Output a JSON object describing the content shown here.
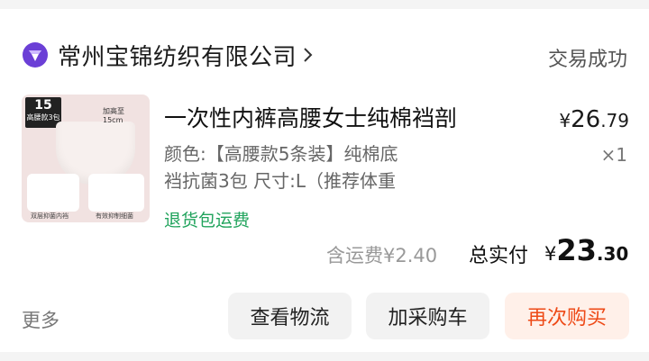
{
  "store": {
    "name": "常州宝锦纺织有限公司",
    "status": "交易成功",
    "icon": "shop-diamond-icon",
    "accent": "#6b3fd6"
  },
  "product": {
    "thumb_badge": "15",
    "thumb_badge_sub": "高腰款3包",
    "thumb_label_1": "加高至",
    "thumb_label_2": "15cm",
    "thumb_caption_1": "双层抑菌内裆",
    "thumb_caption_2": "有效抑制细菌",
    "title": "一次性内裤高腰女士纯棉裆剖",
    "spec_line1": "颜色:【高腰款5条装】纯棉底",
    "spec_line2": "裆抗菌3包 尺寸:L（推荐体重",
    "returns": "退货包运费",
    "price_currency": "¥",
    "price_int": "26",
    "price_dec": ".79",
    "quantity": "×1"
  },
  "summary": {
    "shipping": "含运费¥2.40",
    "total_label": "总实付",
    "total_currency": "¥",
    "total_int": "23",
    "total_dec": ".30"
  },
  "actions": {
    "more": "更多",
    "logistics": "查看物流",
    "add_to_cart": "加采购车",
    "rebuy": "再次购买"
  },
  "colors": {
    "returns_green": "#20a35c",
    "rebuy_orange": "#ee4a17",
    "rebuy_bg": "#fff0e9"
  }
}
